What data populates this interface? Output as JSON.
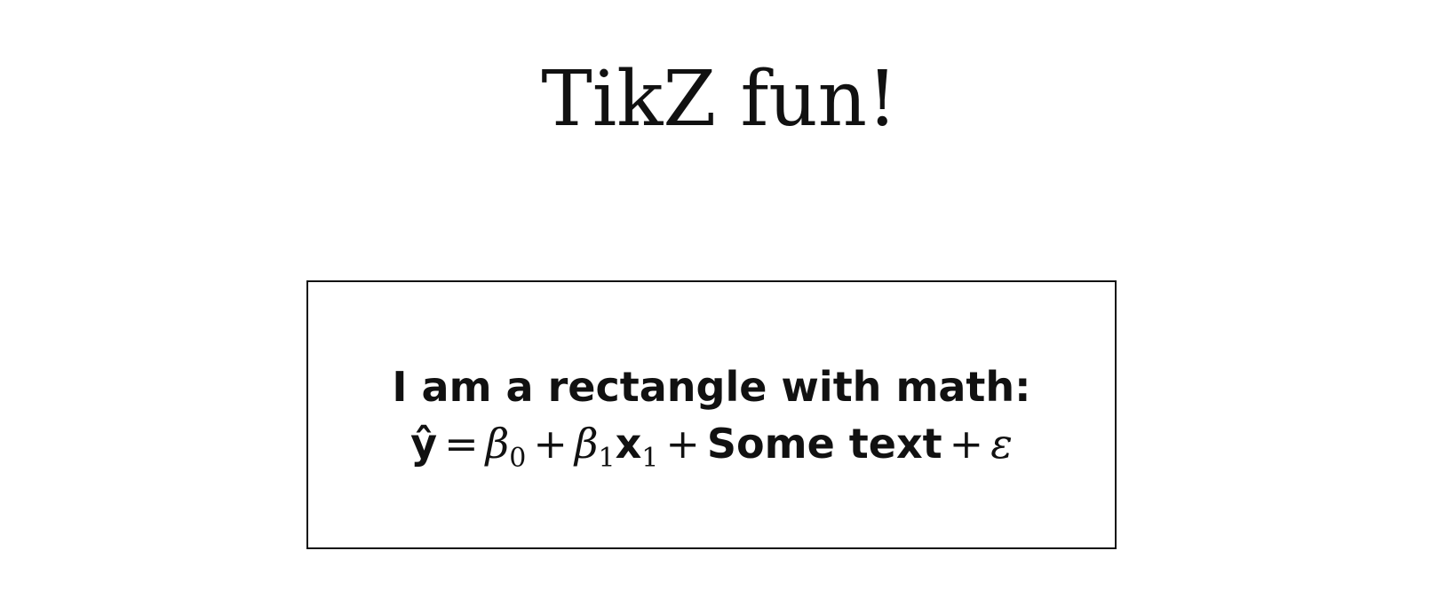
{
  "title": "TikZ fun!",
  "rectangle": {
    "caption": "I am a rectangle with math:",
    "equation": {
      "lhs": "ŷ",
      "equals": "=",
      "beta": "β",
      "sub0": "0",
      "plus": "+",
      "sub1": "1",
      "x": "x",
      "text": "Some text",
      "epsilon": "ε"
    }
  }
}
